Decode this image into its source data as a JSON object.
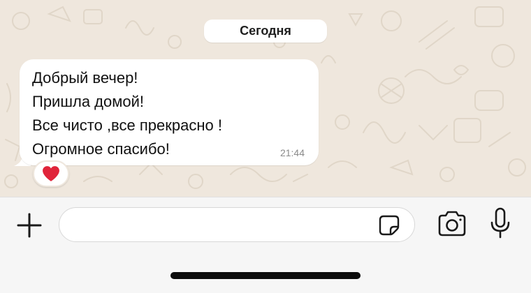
{
  "chat": {
    "date_label": "Сегодня",
    "message": {
      "lines": [
        "Добрый вечер!",
        "Пришла домой!",
        "Все чисто ,все прекрасно !",
        "Огромное спасибо!"
      ],
      "time": "21:44",
      "reaction": "❤️"
    }
  },
  "composer": {
    "input_value": "",
    "plus_icon": "plus-icon",
    "sticker_icon": "sticker-icon",
    "camera_icon": "camera-icon",
    "mic_icon": "microphone-icon"
  },
  "colors": {
    "wallpaper": "#efe7dd",
    "bubble": "#ffffff",
    "composer_bg": "#f6f6f6",
    "time_text": "#8a8a8a",
    "heart": "#e0243a"
  }
}
